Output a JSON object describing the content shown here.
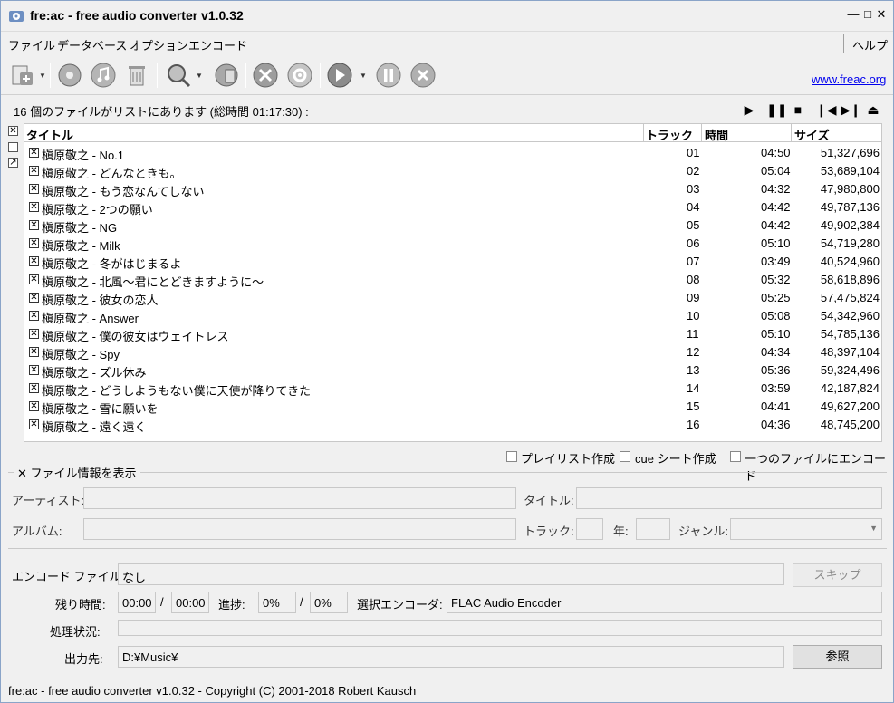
{
  "window": {
    "title": "fre:ac - free audio converter v1.0.32"
  },
  "menu": {
    "file": "ファイル",
    "database": "データベース",
    "options": "オプション",
    "encode": "エンコード",
    "help": "ヘルプ"
  },
  "toolbar": {
    "site_link": "www.freac.org"
  },
  "list": {
    "status": "16 個のファイルがリストにあります (総時間 01:17:30) :",
    "columns": {
      "title": "タイトル",
      "track": "トラック",
      "time": "時間",
      "size": "サイズ"
    },
    "rows": [
      {
        "title": "槇原敬之 - No.1",
        "track": "01",
        "time": "04:50",
        "size": "51,327,696"
      },
      {
        "title": "槇原敬之 - どんなときも。",
        "track": "02",
        "time": "05:04",
        "size": "53,689,104"
      },
      {
        "title": "槇原敬之 - もう恋なんてしない",
        "track": "03",
        "time": "04:32",
        "size": "47,980,800"
      },
      {
        "title": "槇原敬之 - 2つの願い",
        "track": "04",
        "time": "04:42",
        "size": "49,787,136"
      },
      {
        "title": "槇原敬之 - NG",
        "track": "05",
        "time": "04:42",
        "size": "49,902,384"
      },
      {
        "title": "槇原敬之 - Milk",
        "track": "06",
        "time": "05:10",
        "size": "54,719,280"
      },
      {
        "title": "槇原敬之 - 冬がはじまるよ",
        "track": "07",
        "time": "03:49",
        "size": "40,524,960"
      },
      {
        "title": "槇原敬之 - 北風～君にとどきますように～",
        "track": "08",
        "time": "05:32",
        "size": "58,618,896"
      },
      {
        "title": "槇原敬之 - 彼女の恋人",
        "track": "09",
        "time": "05:25",
        "size": "57,475,824"
      },
      {
        "title": "槇原敬之 - Answer",
        "track": "10",
        "time": "05:08",
        "size": "54,342,960"
      },
      {
        "title": "槇原敬之 - 僕の彼女はウェイトレス",
        "track": "11",
        "time": "05:10",
        "size": "54,785,136"
      },
      {
        "title": "槇原敬之 - Spy",
        "track": "12",
        "time": "04:34",
        "size": "48,397,104"
      },
      {
        "title": "槇原敬之 - ズル休み",
        "track": "13",
        "time": "05:36",
        "size": "59,324,496"
      },
      {
        "title": "槇原敬之 - どうしようもない僕に天使が降りてきた",
        "track": "14",
        "time": "03:59",
        "size": "42,187,824"
      },
      {
        "title": "槇原敬之 - 雪に願いを",
        "track": "15",
        "time": "04:41",
        "size": "49,627,200"
      },
      {
        "title": "槇原敬之 - 遠く遠く",
        "track": "16",
        "time": "04:36",
        "size": "48,745,200"
      }
    ]
  },
  "options": {
    "playlist": "プレイリスト作成",
    "cue": "cue シート作成",
    "single_file": "一つのファイルにエンコード"
  },
  "file_info": {
    "legend": "ファイル情報を表示",
    "artist_label": "アーティスト:",
    "title_label": "タイトル:",
    "album_label": "アルバム:",
    "track_label": "トラック:",
    "year_label": "年:",
    "genre_label": "ジャンル:"
  },
  "encode": {
    "file_label": "エンコード ファイル:",
    "file_value": "なし",
    "skip": "スキップ",
    "remaining_label": "残り時間:",
    "remaining_1": "00:00",
    "remaining_2": "00:00",
    "slash": "/",
    "progress_label": "進捗:",
    "progress_1": "0%",
    "progress_2": "0%",
    "encoder_label": "選択エンコーダ:",
    "encoder_value": "FLAC Audio Encoder",
    "status_label": "処理状況:",
    "progress_fraction": 0,
    "output_label": "出力先:",
    "output_value": "D:¥Music¥",
    "browse": "参照"
  },
  "statusbar": {
    "text": "fre:ac - free audio converter v1.0.32 - Copyright (C) 2001-2018 Robert Kausch"
  }
}
